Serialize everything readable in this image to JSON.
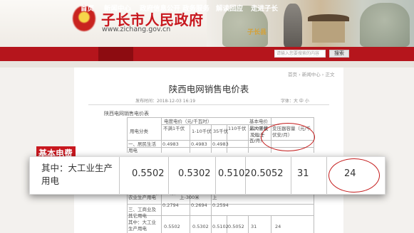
{
  "header": {
    "site_title": "子长市人民政府",
    "site_url": "www.zichang.gov.cn",
    "photo_sign": "子长县",
    "colors": {
      "brand_red": "#c8181f",
      "nav_red": "#b5151c",
      "nav_active": "#8d0c11"
    }
  },
  "nav": {
    "items": [
      "首页",
      "新闻中心",
      "政府信息公开",
      "政务服务",
      "解读回应",
      "走进子长"
    ],
    "active": "新闻中心"
  },
  "search": {
    "placeholder": "请输入您要搜索的内容",
    "button": "搜索"
  },
  "breadcrumb": "首页 › 新闻中心 › 正文",
  "article": {
    "title": "陕西电网销售电价表",
    "date_line": "发布时间：2018-12-03 16:19",
    "font_size": "字体：大 中 小",
    "caption": "陕西电网销售电价表"
  },
  "table": {
    "header_top": "电度电价（元/千瓦时）",
    "header_basic_price": "基本电价",
    "header_category": "用电分类",
    "col_headers": [
      "不满1千伏",
      "1-10千伏",
      "35千伏",
      "110千伏",
      "220千伏及以上"
    ],
    "col_max_demand": "最大需量（元/千瓦/月）",
    "col_capacity": "变压器容量（元/千伏安/月）",
    "row_residential_label": "一、居民生活用电",
    "row_residential_values": [
      "0.4983",
      "0.4983",
      "0.4983"
    ],
    "row_agri_label": "农业生产用电",
    "row_agri_note_1": "米 -100米",
    "row_agri_note_2": "上-300米",
    "row_agri_note_3": "上",
    "row_agri_values": [
      "0.2794",
      "0.2694",
      "0.2594"
    ],
    "row_industry_label": "三、工商业及其它用电",
    "row_industry_sub_label": "其中：大工业生产用电",
    "row_industry_values": [
      "0.5502",
      "0.5302",
      "0.5102",
      "0.5052",
      "31",
      "24"
    ]
  },
  "zoom": {
    "label": "基本电费",
    "row_label": "其中：大工业生产用电",
    "values": [
      "0.5502",
      "0.5302",
      "0.5102",
      "0.5052",
      "31",
      "24"
    ]
  }
}
